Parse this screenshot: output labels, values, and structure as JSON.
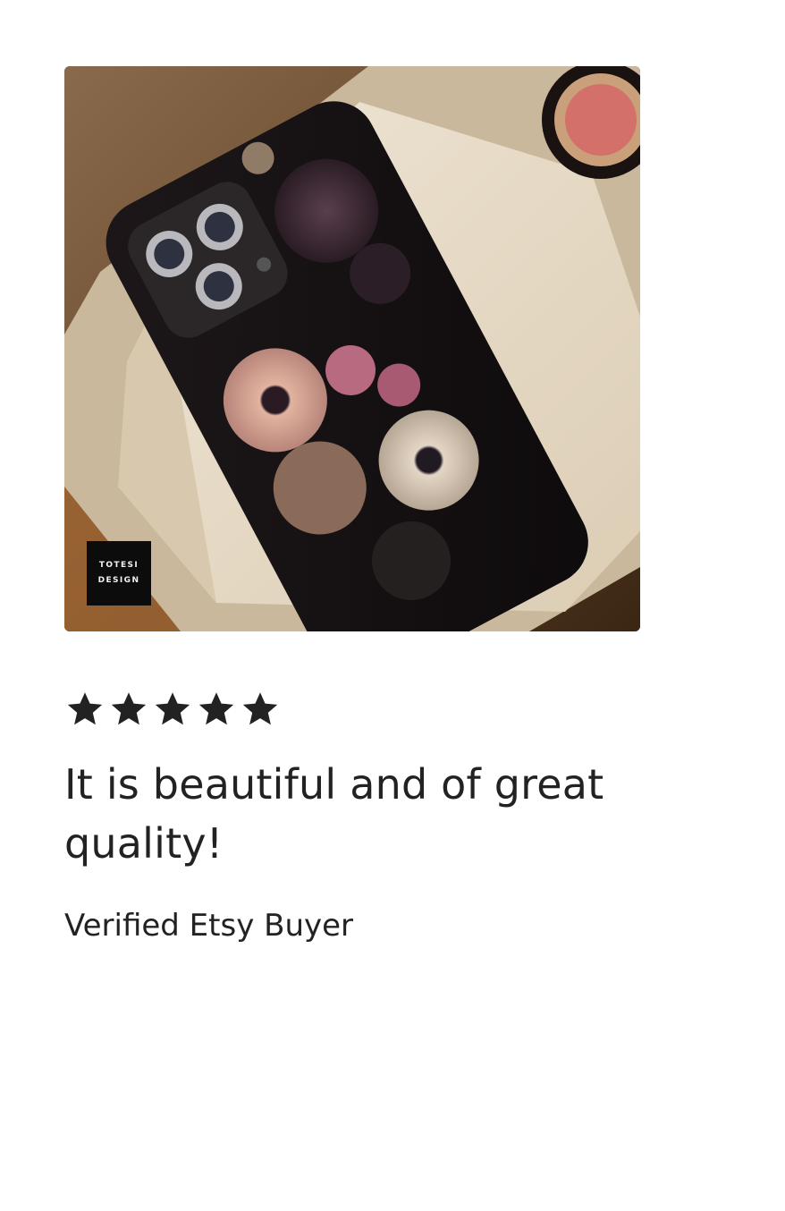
{
  "review": {
    "photo": {
      "alt": "Floral phone case on a white stool",
      "logo_line1": "TOTESI",
      "logo_line2": "DESIGN"
    },
    "rating": 5,
    "rating_max": 5,
    "text": "It is beautiful and of great quality!",
    "reviewer": "Verified Etsy Buyer"
  },
  "colors": {
    "text": "#222222",
    "star": "#222222",
    "background": "#ffffff"
  },
  "icons": {
    "star": "star-icon"
  }
}
